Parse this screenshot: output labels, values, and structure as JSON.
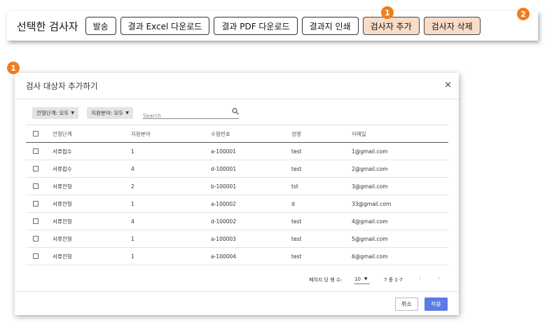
{
  "toolbar": {
    "label": "선택한 검사자",
    "buttons": {
      "send": "발송",
      "excel": "결과 Excel 다운로드",
      "pdf": "결과 PDF 다운로드",
      "print": "결과지 인쇄",
      "add": "검사자 추가",
      "delete": "검사자 삭제"
    },
    "accent_color": "#f9dcc8"
  },
  "badges": {
    "one": "1",
    "two": "2",
    "color": "#ef7d1f"
  },
  "dialog": {
    "title": "검사 대상자 추가하기",
    "close": "×",
    "filters": {
      "stage": "전형단계: 모두",
      "field": "지원분야: 모두"
    },
    "search": {
      "placeholder": "Search",
      "icon": "search-icon"
    },
    "columns": [
      "전형단계",
      "지원분야",
      "수험번호",
      "성명",
      "이메일"
    ],
    "rows": [
      [
        "서류접수",
        "1",
        "a-100001",
        "test",
        "1@gmail.com"
      ],
      [
        "서류접수",
        "4",
        "d-100001",
        "test",
        "2@gmail.com"
      ],
      [
        "서류전형",
        "2",
        "b-100001",
        "tst",
        "3@gmail.com"
      ],
      [
        "서류전형",
        "1",
        "a-100002",
        "d",
        "33@gmail.com"
      ],
      [
        "서류전형",
        "4",
        "d-100002",
        "test",
        "4@gmail.com"
      ],
      [
        "서류전형",
        "1",
        "a-100003",
        "test",
        "5@gmail.com"
      ],
      [
        "서류전형",
        "1",
        "a-100004",
        "test",
        "6@gmail.com"
      ]
    ],
    "pager": {
      "label": "페이지 당 행 수:",
      "per_page": "10",
      "range": "7 중 1-7"
    },
    "footer": {
      "cancel": "취소",
      "apply": "적용",
      "apply_color": "#5b7be5"
    }
  }
}
